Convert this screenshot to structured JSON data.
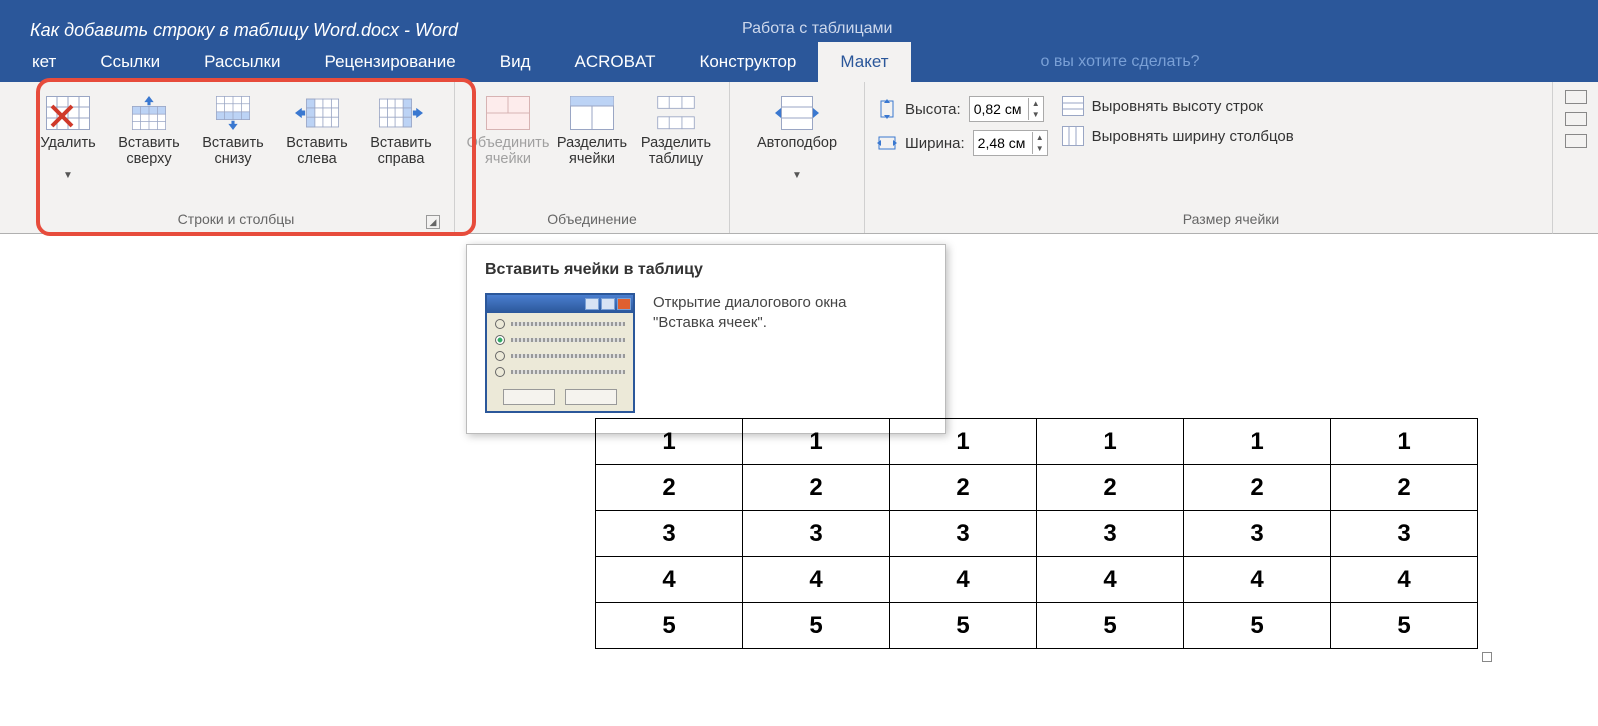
{
  "title": "Как добавить строку в таблицу Word.docx - Word",
  "contextual_title": "Работа с таблицами",
  "tabs": {
    "cut": "кет",
    "links": "Ссылки",
    "mail": "Рассылки",
    "review": "Рецензирование",
    "view": "Вид",
    "acrobat": "ACROBAT",
    "design": "Конструктор",
    "layout": "Макет",
    "tellme": "о вы хотите сделать?"
  },
  "groups": {
    "rows_cols": {
      "label": "Строки и столбцы",
      "delete": "Удалить",
      "ins_above": "Вставить сверху",
      "ins_below": "Вставить снизу",
      "ins_left": "Вставить слева",
      "ins_right": "Вставить справа"
    },
    "merge": {
      "label": "Объединение",
      "merge_cells": "Объединить ячейки",
      "split_cells": "Разделить ячейки",
      "split_table": "Разделить таблицу"
    },
    "autofit": "Автоподбор",
    "size": {
      "label": "Размер ячейки",
      "height_lbl": "Высота:",
      "width_lbl": "Ширина:",
      "height_val": "0,82 см",
      "width_val": "2,48 см",
      "dist_rows": "Выровнять высоту строк",
      "dist_cols": "Выровнять ширину столбцов"
    }
  },
  "tooltip": {
    "title": "Вставить ячейки в таблицу",
    "line1": "Открытие диалогового окна",
    "line2": "\"Вставка ячеек\"."
  },
  "table": [
    [
      "1",
      "1",
      "1",
      "1",
      "1",
      "1"
    ],
    [
      "2",
      "2",
      "2",
      "2",
      "2",
      "2"
    ],
    [
      "3",
      "3",
      "3",
      "3",
      "3",
      "3"
    ],
    [
      "4",
      "4",
      "4",
      "4",
      "4",
      "4"
    ],
    [
      "5",
      "5",
      "5",
      "5",
      "5",
      "5"
    ]
  ]
}
